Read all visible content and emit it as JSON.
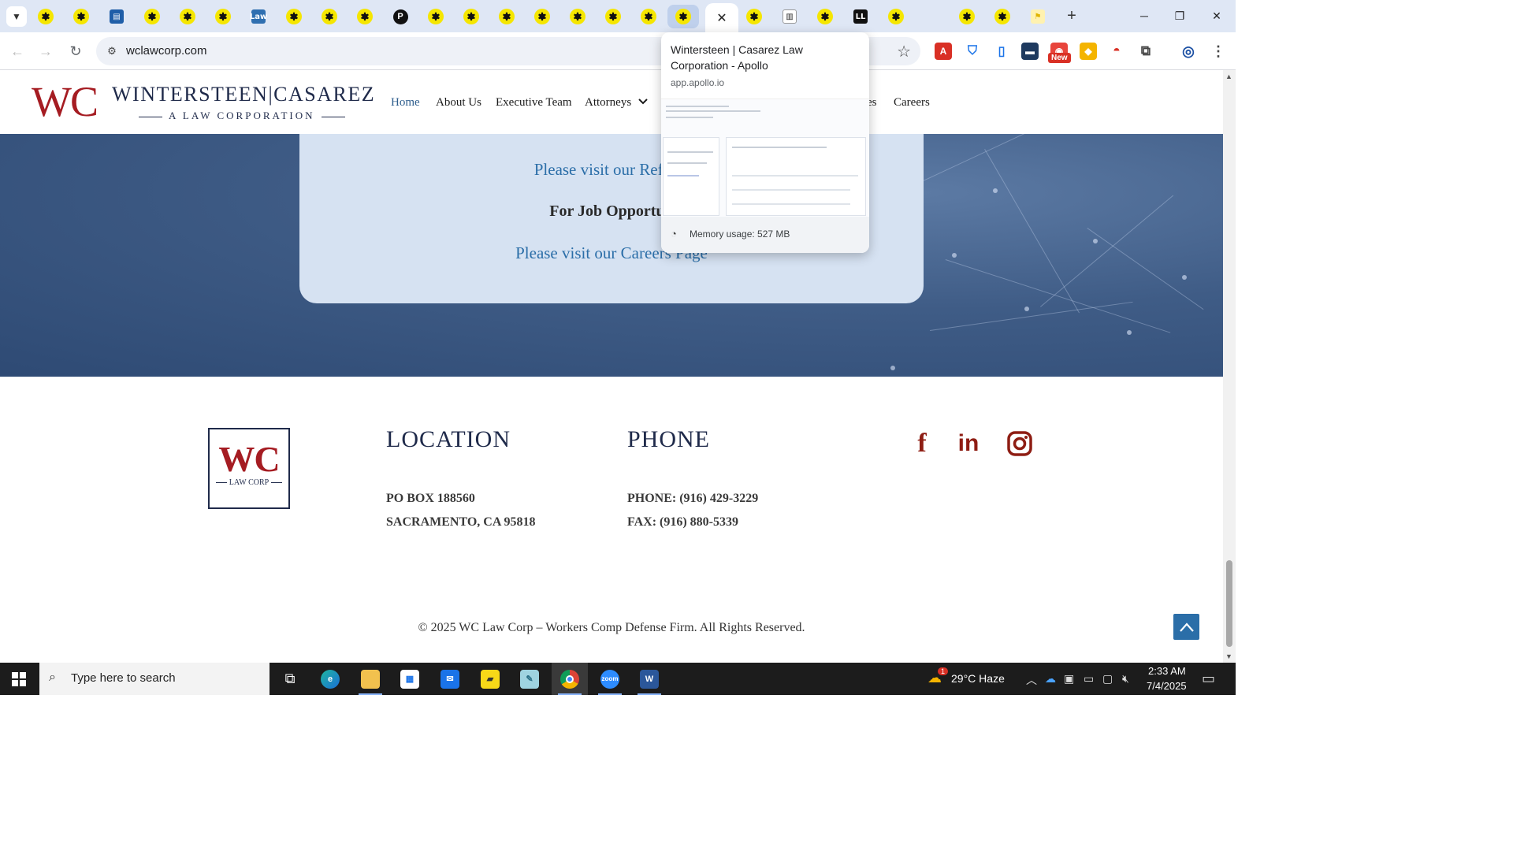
{
  "browser": {
    "url": "wclawcorp.com",
    "tabs": [
      {
        "icon": "asterisk-favicon-icon"
      },
      {
        "icon": "asterisk-favicon-icon"
      },
      {
        "icon": "blue-doc-favicon-icon"
      },
      {
        "icon": "asterisk-favicon-icon"
      },
      {
        "icon": "asterisk-favicon-icon"
      },
      {
        "icon": "asterisk-favicon-icon"
      },
      {
        "icon": "law-favicon-icon",
        "text": "Law"
      },
      {
        "icon": "asterisk-favicon-icon"
      },
      {
        "icon": "asterisk-favicon-icon"
      },
      {
        "icon": "asterisk-favicon-icon"
      },
      {
        "icon": "p-favicon-icon",
        "text": "P"
      },
      {
        "icon": "asterisk-favicon-icon"
      },
      {
        "icon": "asterisk-favicon-icon"
      },
      {
        "icon": "asterisk-favicon-icon"
      },
      {
        "icon": "asterisk-favicon-icon"
      },
      {
        "icon": "asterisk-favicon-icon"
      },
      {
        "icon": "asterisk-favicon-icon"
      },
      {
        "icon": "asterisk-favicon-icon"
      },
      {
        "icon": "asterisk-favicon-icon",
        "state": "hovered"
      },
      {
        "icon": "close-icon",
        "state": "active"
      },
      {
        "icon": "asterisk-favicon-icon"
      },
      {
        "icon": "book-favicon-icon"
      },
      {
        "icon": "asterisk-favicon-icon"
      },
      {
        "icon": "ll-favicon-icon",
        "text": "LL"
      },
      {
        "icon": "asterisk-favicon-icon"
      },
      {
        "icon": "blank-favicon-icon"
      },
      {
        "icon": "asterisk-favicon-icon"
      },
      {
        "icon": "asterisk-favicon-icon"
      },
      {
        "icon": "yellow-flag-favicon-icon"
      }
    ],
    "ext_new_badge": "New"
  },
  "hover_card": {
    "title": "Wintersteen | Casarez Law Corporation - Apollo",
    "domain": "app.apollo.io",
    "memory": "Memory usage: 527 MB"
  },
  "site": {
    "logo_letters": "WC",
    "logo_name": "WINTERSTEEN|CASAREZ",
    "logo_tagline": "A LAW CORPORATION",
    "nav": [
      "Home",
      "About Us",
      "Executive Team",
      "Attorneys",
      "es",
      "Careers"
    ],
    "card": {
      "referral_link": "Please visit our Referra",
      "job_heading": "For Job Opportun",
      "careers_link": "Please visit our Careers Page"
    },
    "footer": {
      "logo_letters": "WC",
      "logo_sub": "LAW CORP",
      "location_title": "LOCATION",
      "location_lines": [
        "PO BOX 188560",
        "SACRAMENTO, CA 95818"
      ],
      "phone_title": "PHONE",
      "phone_lines": [
        "PHONE: (916) 429-3229",
        "FAX: (916) 880-5339"
      ],
      "copyright": "© 2025 WC Law Corp – Workers Comp Defense Firm. All Rights Reserved."
    }
  },
  "taskbar": {
    "search_placeholder": "Type here to search",
    "weather": "29°C  Haze",
    "weather_badge": "1",
    "time": "2:33 AM",
    "date": "7/4/2025"
  },
  "colors": {
    "brand_red": "#a51c22",
    "brand_navy": "#1f2a4a",
    "link_blue": "#2b6ea8",
    "social_red": "#8e1d13"
  }
}
